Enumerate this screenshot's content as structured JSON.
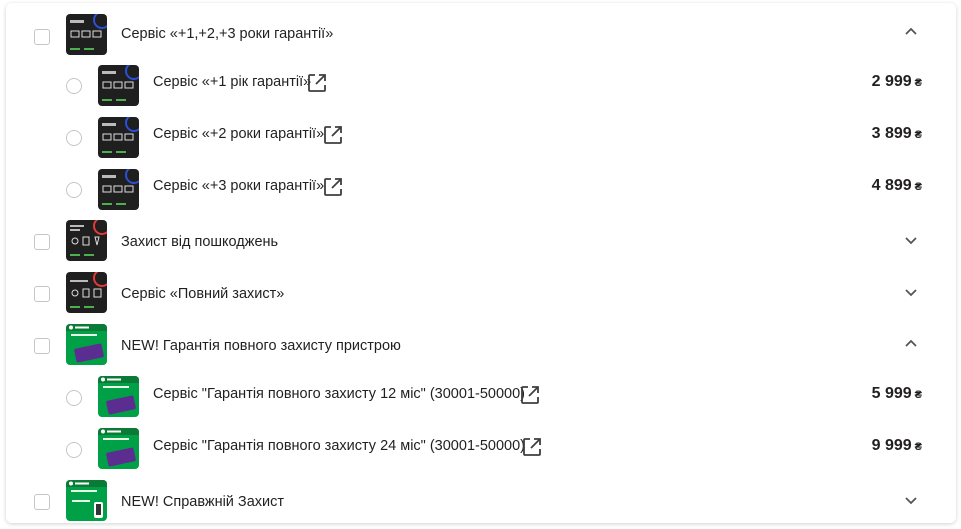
{
  "groups": [
    {
      "title": "Сервіс «+1,+2,+3 роки гарантії»",
      "thumb_icon": "dark-warranty-card",
      "expanded": true,
      "chevron": "chevron-up-icon",
      "options": [
        {
          "title": "Сервіс «+1 рік гарантії»",
          "price": "2 999",
          "currency": "₴"
        },
        {
          "title": "Сервіс «+2 роки гарантії»",
          "price": "3 899",
          "currency": "₴"
        },
        {
          "title": "Сервіс «+3 роки гарантії»",
          "price": "4 899",
          "currency": "₴"
        }
      ]
    },
    {
      "title": "Захист від пошкоджень",
      "thumb_icon": "dark-damage-protection-card",
      "expanded": false,
      "chevron": "chevron-down-icon"
    },
    {
      "title": "Сервіс «Повний захист»",
      "thumb_icon": "dark-full-protection-card",
      "expanded": false,
      "chevron": "chevron-down-icon"
    },
    {
      "title": "NEW! Гарантія повного захисту пристрою",
      "thumb_icon": "green-rozetka-card",
      "expanded": true,
      "chevron": "chevron-up-icon",
      "options": [
        {
          "title": "Сервіс \"Гарантія повного захисту 12 міс\" (30001-50000)",
          "price": "5 999",
          "currency": "₴"
        },
        {
          "title": "Сервіс \"Гарантія повного захисту 24 міс\" (30001-50000)",
          "price": "9 999",
          "currency": "₴"
        }
      ]
    },
    {
      "title": "NEW! Справжній Захист",
      "thumb_icon": "green-rozetka-phone-card",
      "expanded": false,
      "chevron": "chevron-down-icon"
    }
  ],
  "colors": {
    "text": "#221f1f",
    "border": "#c6c6c6",
    "dark_card": "#1f1f1f",
    "green_card": "#00a046",
    "purple_card": "#5c2d91",
    "link_icon": "#3e3e3e"
  }
}
